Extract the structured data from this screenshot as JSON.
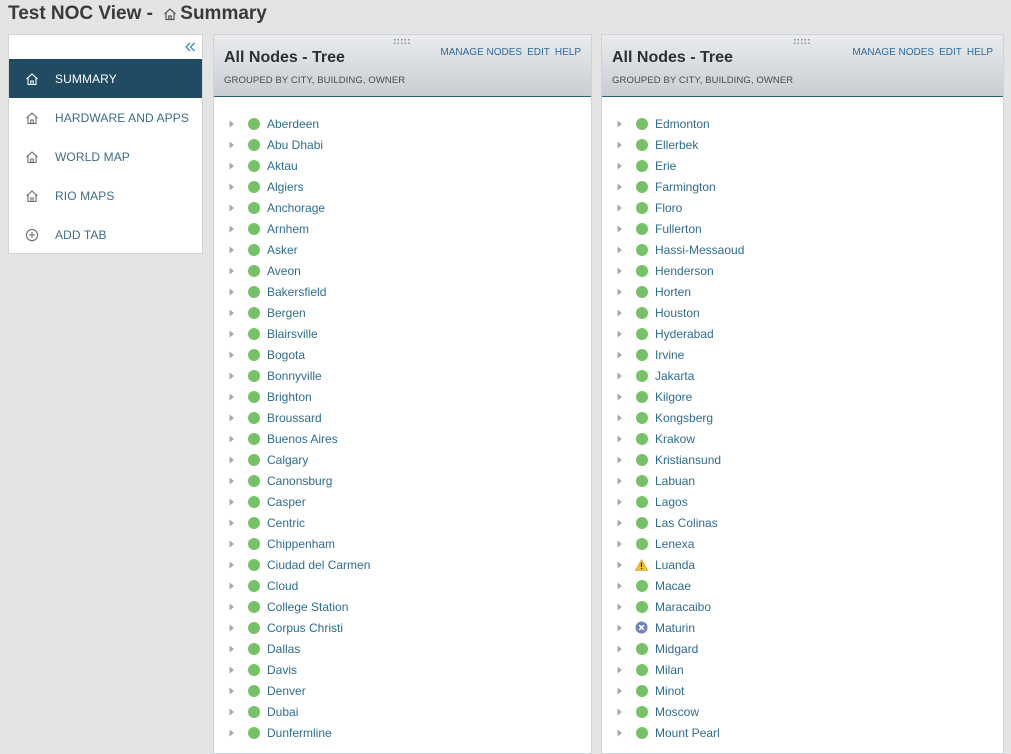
{
  "header": {
    "prefix": "Test NOC View - ",
    "current": "Summary"
  },
  "sidebar": {
    "items": [
      {
        "label": "SUMMARY",
        "icon": "home-icon",
        "active": true
      },
      {
        "label": "HARDWARE AND APPS",
        "icon": "home-icon",
        "active": false
      },
      {
        "label": "WORLD MAP",
        "icon": "home-icon",
        "active": false
      },
      {
        "label": "RIO MAPS",
        "icon": "home-icon",
        "active": false
      },
      {
        "label": "ADD TAB",
        "icon": "plus-circle-icon",
        "active": false
      }
    ]
  },
  "colors": {
    "accent": "#204b63",
    "link": "#2f6c8e",
    "status_up": "#77c168",
    "status_warning": "#f2c230",
    "status_unknown": "#6f84b5"
  },
  "panels": [
    {
      "title": "All Nodes - Tree",
      "subtitle": "GROUPED BY CITY, BUILDING, OWNER",
      "actions": {
        "manage": "MANAGE NODES",
        "edit": "EDIT",
        "help": "HELP"
      },
      "nodes": [
        {
          "name": "Aberdeen",
          "status": "up"
        },
        {
          "name": "Abu Dhabi",
          "status": "up"
        },
        {
          "name": "Aktau",
          "status": "up"
        },
        {
          "name": "Algiers",
          "status": "up"
        },
        {
          "name": "Anchorage",
          "status": "up"
        },
        {
          "name": "Arnhem",
          "status": "up"
        },
        {
          "name": "Asker",
          "status": "up"
        },
        {
          "name": "Aveon",
          "status": "up"
        },
        {
          "name": "Bakersfield",
          "status": "up"
        },
        {
          "name": "Bergen",
          "status": "up"
        },
        {
          "name": "Blairsville",
          "status": "up"
        },
        {
          "name": "Bogota",
          "status": "up"
        },
        {
          "name": "Bonnyville",
          "status": "up"
        },
        {
          "name": "Brighton",
          "status": "up"
        },
        {
          "name": "Broussard",
          "status": "up"
        },
        {
          "name": "Buenos Aires",
          "status": "up"
        },
        {
          "name": "Calgary",
          "status": "up"
        },
        {
          "name": "Canonsburg",
          "status": "up"
        },
        {
          "name": "Casper",
          "status": "up"
        },
        {
          "name": "Centric",
          "status": "up"
        },
        {
          "name": "Chippenham",
          "status": "up"
        },
        {
          "name": "Ciudad del Carmen",
          "status": "up"
        },
        {
          "name": "Cloud",
          "status": "up"
        },
        {
          "name": "College Station",
          "status": "up"
        },
        {
          "name": "Corpus Christi",
          "status": "up"
        },
        {
          "name": "Dallas",
          "status": "up"
        },
        {
          "name": "Davis",
          "status": "up"
        },
        {
          "name": "Denver",
          "status": "up"
        },
        {
          "name": "Dubai",
          "status": "up"
        },
        {
          "name": "Dunfermline",
          "status": "up"
        }
      ]
    },
    {
      "title": "All Nodes - Tree",
      "subtitle": "GROUPED BY CITY, BUILDING, OWNER",
      "actions": {
        "manage": "MANAGE NODES",
        "edit": "EDIT",
        "help": "HELP"
      },
      "nodes": [
        {
          "name": "Edmonton",
          "status": "up"
        },
        {
          "name": "Ellerbek",
          "status": "up"
        },
        {
          "name": "Erie",
          "status": "up"
        },
        {
          "name": "Farmington",
          "status": "up"
        },
        {
          "name": "Floro",
          "status": "up"
        },
        {
          "name": "Fullerton",
          "status": "up"
        },
        {
          "name": "Hassi-Messaoud",
          "status": "up"
        },
        {
          "name": "Henderson",
          "status": "up"
        },
        {
          "name": "Horten",
          "status": "up"
        },
        {
          "name": "Houston",
          "status": "up"
        },
        {
          "name": "Hyderabad",
          "status": "up"
        },
        {
          "name": "Irvine",
          "status": "up"
        },
        {
          "name": "Jakarta",
          "status": "up"
        },
        {
          "name": "Kilgore",
          "status": "up"
        },
        {
          "name": "Kongsberg",
          "status": "up"
        },
        {
          "name": "Krakow",
          "status": "up"
        },
        {
          "name": "Kristiansund",
          "status": "up"
        },
        {
          "name": "Labuan",
          "status": "up"
        },
        {
          "name": "Lagos",
          "status": "up"
        },
        {
          "name": "Las Colinas",
          "status": "up"
        },
        {
          "name": "Lenexa",
          "status": "up"
        },
        {
          "name": "Luanda",
          "status": "warning"
        },
        {
          "name": "Macae",
          "status": "up"
        },
        {
          "name": "Maracaibo",
          "status": "up"
        },
        {
          "name": "Maturin",
          "status": "unknown"
        },
        {
          "name": "Midgard",
          "status": "up"
        },
        {
          "name": "Milan",
          "status": "up"
        },
        {
          "name": "Minot",
          "status": "up"
        },
        {
          "name": "Moscow",
          "status": "up"
        },
        {
          "name": "Mount Pearl",
          "status": "up"
        }
      ]
    }
  ]
}
